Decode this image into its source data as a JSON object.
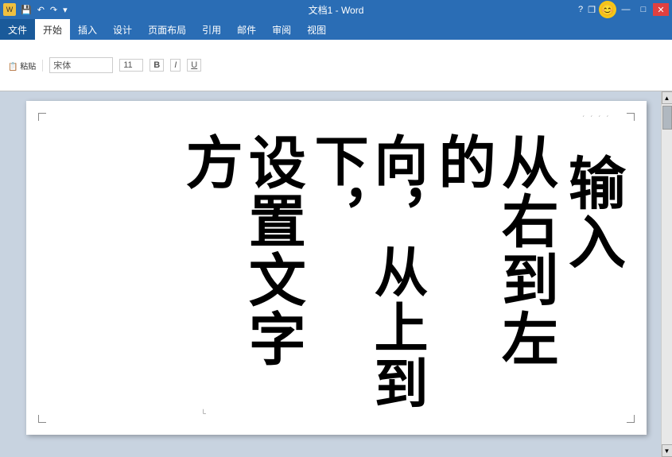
{
  "titlebar": {
    "title": "文档1 - Word",
    "help_label": "?",
    "restore_label": "❐",
    "minimize_label": "—",
    "maximize_label": "□",
    "close_label": "✕",
    "avatar_emoji": "😊"
  },
  "quickaccess": {
    "save_label": "💾",
    "undo_label": "↶",
    "redo_label": "↷",
    "dropdown_label": "▾"
  },
  "ribbon": {
    "tabs": [
      {
        "label": "文件",
        "active": false
      },
      {
        "label": "开始",
        "active": true
      },
      {
        "label": "插入",
        "active": false
      },
      {
        "label": "设计",
        "active": false
      },
      {
        "label": "页面布局",
        "active": false
      },
      {
        "label": "引用",
        "active": false
      },
      {
        "label": "邮件",
        "active": false
      },
      {
        "label": "审阅",
        "active": false
      },
      {
        "label": "视图",
        "active": false
      }
    ]
  },
  "document": {
    "text_columns": [
      "设置文字方",
      "向，从上到下，",
      "从右到左的",
      "输入"
    ],
    "dots": "ˊ ˊ ˊ ˊ"
  },
  "scrollbar": {
    "up_label": "▲",
    "down_label": "▼"
  }
}
